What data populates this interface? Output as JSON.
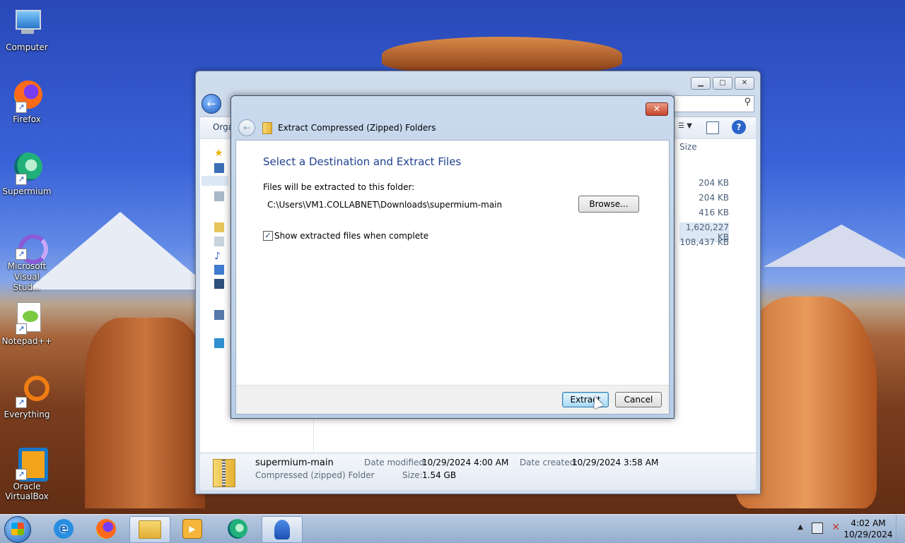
{
  "desktop_icons": [
    {
      "label": "Computer",
      "icon": "computer-icon"
    },
    {
      "label": "Firefox",
      "icon": "firefox-icon"
    },
    {
      "label": "Supermium",
      "icon": "supermium-icon"
    },
    {
      "label": "Microsoft Visual Stud...",
      "icon": "visual-studio-icon"
    },
    {
      "label": "Notepad++",
      "icon": "notepadpp-icon"
    },
    {
      "label": "Everything",
      "icon": "everything-icon"
    },
    {
      "label": "Oracle VirtualBox",
      "icon": "virtualbox-icon"
    }
  ],
  "explorer": {
    "toolbar_organize": "Orga",
    "column_size": "Size",
    "sizes": [
      "204 KB",
      "204 KB",
      "416 KB",
      "1,620,227 KB",
      "108,437 KB"
    ],
    "details": {
      "name": "supermium-main",
      "type": "Compressed (zipped) Folder",
      "date_modified_label": "Date modified:",
      "date_modified": "10/29/2024 4:00 AM",
      "date_created_label": "Date created:",
      "date_created": "10/29/2024 3:58 AM",
      "size_label": "Size:",
      "size": "1.54 GB"
    }
  },
  "dialog": {
    "title": "Extract Compressed (Zipped) Folders",
    "heading": "Select a Destination and Extract Files",
    "folder_label": "Files will be extracted to this folder:",
    "path": "C:\\Users\\VM1.COLLABNET\\Downloads\\supermium-main",
    "browse": "Browse...",
    "show_files_label": "Show extracted files when complete",
    "show_files_checked": true,
    "extract": "Extract",
    "cancel": "Cancel"
  },
  "taskbar": {
    "time": "4:02 AM",
    "date": "10/29/2024"
  }
}
